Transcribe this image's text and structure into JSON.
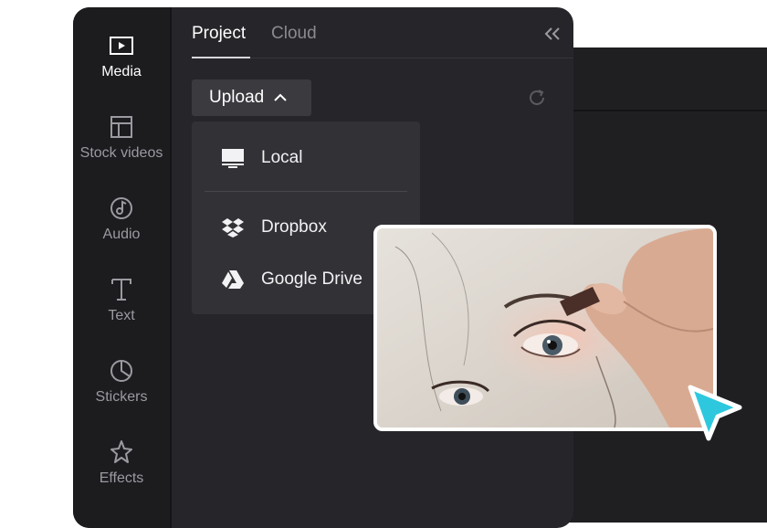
{
  "sidebar": {
    "items": [
      {
        "label": "Media",
        "icon": "media-play-icon",
        "active": true
      },
      {
        "label": "Stock videos",
        "icon": "stock-layout-icon",
        "active": false
      },
      {
        "label": "Audio",
        "icon": "music-note-icon",
        "active": false
      },
      {
        "label": "Text",
        "icon": "text-t-icon",
        "active": false
      },
      {
        "label": "Stickers",
        "icon": "sticker-icon",
        "active": false
      },
      {
        "label": "Effects",
        "icon": "effects-star-icon",
        "active": false
      }
    ]
  },
  "tabs": [
    {
      "label": "Project",
      "active": true
    },
    {
      "label": "Cloud",
      "active": false
    }
  ],
  "toolbar": {
    "upload_label": "Upload",
    "collapse_icon": "double-chevron-left-icon",
    "refresh_icon": "refresh-icon"
  },
  "upload_menu": {
    "items": [
      {
        "label": "Local",
        "icon": "monitor-icon"
      },
      {
        "label": "Dropbox",
        "icon": "dropbox-icon"
      },
      {
        "label": "Google Drive",
        "icon": "google-drive-icon"
      }
    ]
  },
  "colors": {
    "app_bg": "#26262a",
    "sidebar_bg": "#1c1c1f",
    "accent_cursor": "#2ec8de"
  }
}
